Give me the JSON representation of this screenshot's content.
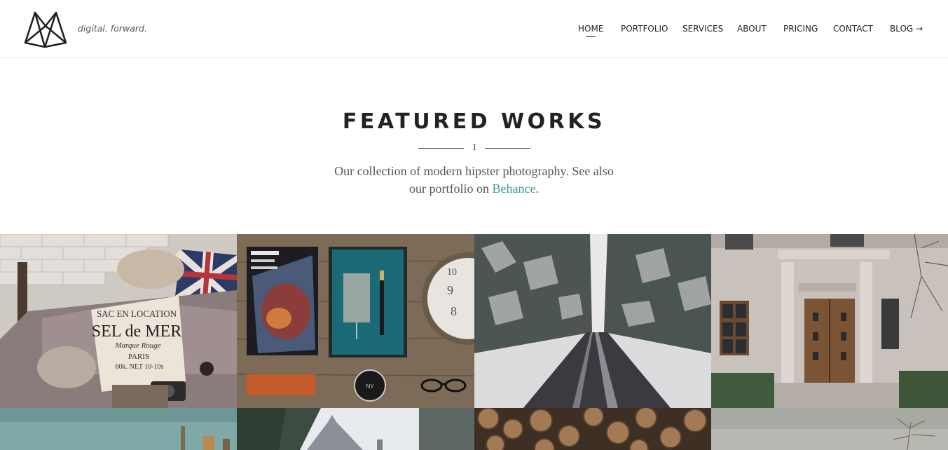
{
  "brand": {
    "logo_icon": "geometric-triangles-logo-icon",
    "tagline": "digital. forward."
  },
  "nav": {
    "items": [
      {
        "label": "HOME",
        "active": true
      },
      {
        "label": "PORTFOLIO",
        "active": false
      },
      {
        "label": "SERVICES",
        "active": false
      },
      {
        "label": "ABOUT",
        "active": false
      },
      {
        "label": "PRICING",
        "active": false
      },
      {
        "label": "CONTACT",
        "active": false
      },
      {
        "label": "BLOG →",
        "active": false
      }
    ]
  },
  "featured": {
    "title": "FEATURED WORKS",
    "divider_mark": "I",
    "intro_text": "Our collection of modern hipster photography. See also our portfolio on",
    "intro_link": "Behance",
    "intro_end": "."
  },
  "gallery": {
    "items": [
      {
        "name": "photo-pillows-union-jack"
      },
      {
        "name": "photo-desk-flatlay-clock"
      },
      {
        "name": "photo-snowy-forest-road"
      },
      {
        "name": "photo-old-building-door"
      },
      {
        "name": "photo-sky-posts"
      },
      {
        "name": "photo-church-roof"
      },
      {
        "name": "photo-firewood-logs"
      },
      {
        "name": "photo-misty-tree"
      }
    ]
  },
  "colors": {
    "accent_link": "#3a9a9a",
    "text_dark": "#222222",
    "text_body": "#555555"
  }
}
